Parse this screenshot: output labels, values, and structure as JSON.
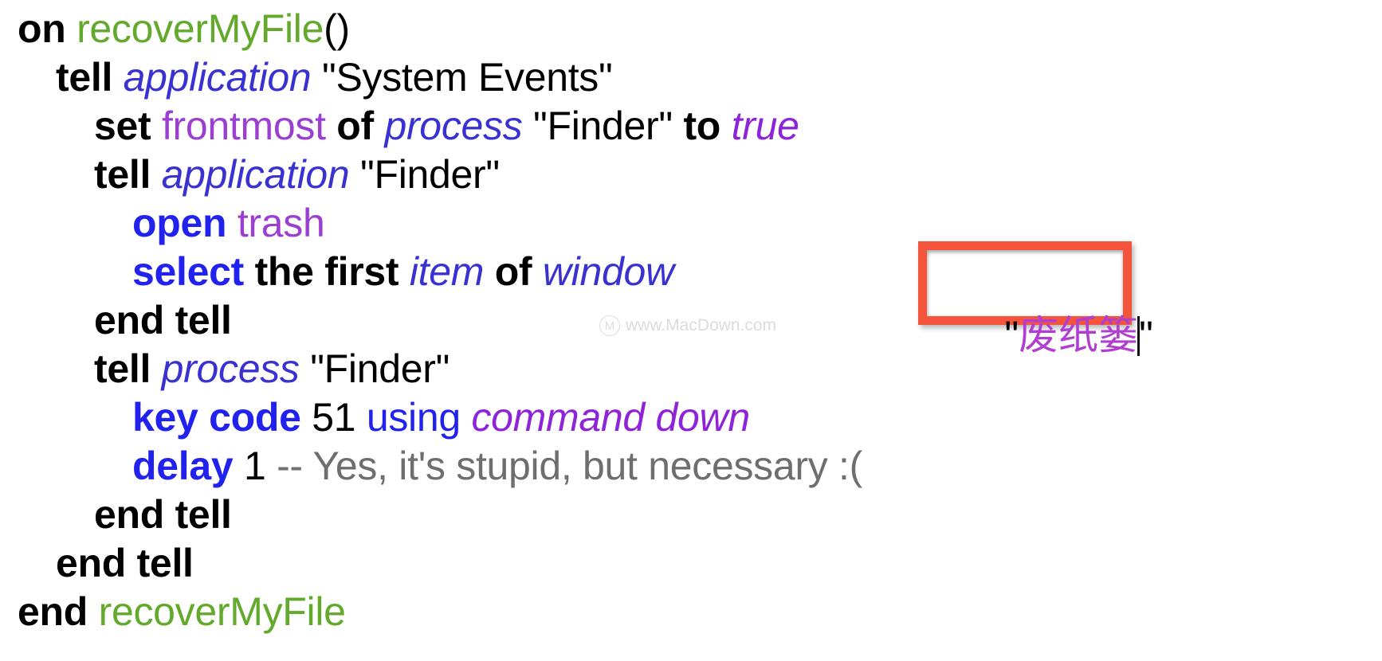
{
  "editor": {
    "language": "AppleScript",
    "background_color": "#ffffff",
    "font_size_px": 50
  },
  "colors": {
    "keyword": "#000000",
    "handler_name": "#62a92c",
    "class_italic": "#3a32d0",
    "command_bold": "#2222ee",
    "property": "#9b3fd0",
    "constant_italic": "#8e24d8",
    "comment": "#6e6e6e",
    "string": "#000000",
    "highlight_border": "#f4543c",
    "cjk_string": "#b03fd0"
  },
  "code": {
    "lines": [
      {
        "id": "line-1",
        "indent": 0,
        "tokens": [
          {
            "text": "on",
            "type": "keyword"
          },
          {
            "text": " ",
            "type": "plain"
          },
          {
            "text": "recoverMyFile",
            "type": "handler"
          },
          {
            "text": "()",
            "type": "plain"
          }
        ]
      },
      {
        "id": "line-2",
        "indent": 1,
        "tokens": [
          {
            "text": "tell",
            "type": "keyword"
          },
          {
            "text": " ",
            "type": "plain"
          },
          {
            "text": "application",
            "type": "class"
          },
          {
            "text": " ",
            "type": "plain"
          },
          {
            "text": "\"System Events\"",
            "type": "string"
          }
        ]
      },
      {
        "id": "line-3",
        "indent": 2,
        "tokens": [
          {
            "text": "set",
            "type": "keyword"
          },
          {
            "text": " ",
            "type": "plain"
          },
          {
            "text": "frontmost",
            "type": "property"
          },
          {
            "text": " ",
            "type": "plain"
          },
          {
            "text": "of",
            "type": "keyword"
          },
          {
            "text": " ",
            "type": "plain"
          },
          {
            "text": "process",
            "type": "class"
          },
          {
            "text": " ",
            "type": "plain"
          },
          {
            "text": "\"Finder\"",
            "type": "string"
          },
          {
            "text": " ",
            "type": "plain"
          },
          {
            "text": "to",
            "type": "keyword"
          },
          {
            "text": " ",
            "type": "plain"
          },
          {
            "text": "true",
            "type": "constant"
          }
        ]
      },
      {
        "id": "line-4",
        "indent": 2,
        "tokens": [
          {
            "text": "tell",
            "type": "keyword"
          },
          {
            "text": " ",
            "type": "plain"
          },
          {
            "text": "application",
            "type": "class"
          },
          {
            "text": " ",
            "type": "plain"
          },
          {
            "text": "\"Finder\"",
            "type": "string"
          }
        ]
      },
      {
        "id": "line-5",
        "indent": 3,
        "tokens": [
          {
            "text": "open",
            "type": "command"
          },
          {
            "text": " ",
            "type": "plain"
          },
          {
            "text": "trash",
            "type": "property"
          }
        ]
      },
      {
        "id": "line-6",
        "indent": 3,
        "tokens": [
          {
            "text": "select",
            "type": "command"
          },
          {
            "text": " ",
            "type": "plain"
          },
          {
            "text": "the first",
            "type": "keyword"
          },
          {
            "text": " ",
            "type": "plain"
          },
          {
            "text": "item",
            "type": "class"
          },
          {
            "text": " ",
            "type": "plain"
          },
          {
            "text": "of",
            "type": "keyword"
          },
          {
            "text": " ",
            "type": "plain"
          },
          {
            "text": "window",
            "type": "class"
          }
        ]
      },
      {
        "id": "line-7",
        "indent": 2,
        "tokens": [
          {
            "text": "end tell",
            "type": "keyword"
          }
        ]
      },
      {
        "id": "line-8",
        "indent": 2,
        "tokens": [
          {
            "text": "tell",
            "type": "keyword"
          },
          {
            "text": " ",
            "type": "plain"
          },
          {
            "text": "process",
            "type": "class"
          },
          {
            "text": " ",
            "type": "plain"
          },
          {
            "text": "\"Finder\"",
            "type": "string"
          }
        ]
      },
      {
        "id": "line-9",
        "indent": 3,
        "tokens": [
          {
            "text": "key code",
            "type": "command"
          },
          {
            "text": " ",
            "type": "plain"
          },
          {
            "text": "51",
            "type": "number"
          },
          {
            "text": " ",
            "type": "plain"
          },
          {
            "text": "using",
            "type": "operator"
          },
          {
            "text": " ",
            "type": "plain"
          },
          {
            "text": "command down",
            "type": "constant"
          }
        ]
      },
      {
        "id": "line-10",
        "indent": 3,
        "tokens": [
          {
            "text": "delay",
            "type": "command"
          },
          {
            "text": " ",
            "type": "plain"
          },
          {
            "text": "1",
            "type": "number"
          },
          {
            "text": " ",
            "type": "plain"
          },
          {
            "text": "-- Yes, it's stupid, but necessary :(",
            "type": "comment"
          }
        ]
      },
      {
        "id": "line-11",
        "indent": 2,
        "tokens": [
          {
            "text": "end tell",
            "type": "keyword"
          }
        ]
      },
      {
        "id": "line-12",
        "indent": 1,
        "tokens": [
          {
            "text": "end tell",
            "type": "keyword"
          }
        ]
      },
      {
        "id": "line-13",
        "indent": 0,
        "tokens": [
          {
            "text": "end",
            "type": "keyword"
          },
          {
            "text": " ",
            "type": "plain"
          },
          {
            "text": "recoverMyFile",
            "type": "handler"
          }
        ]
      }
    ]
  },
  "highlight": {
    "open_quote": "\"",
    "value": "废纸篓",
    "close_quote": "\"",
    "caret_visible": true,
    "border_color": "#f4543c"
  },
  "watermark": {
    "logo": "circled-m-icon",
    "logo_glyph": "M",
    "text": "www.MacDown.com"
  }
}
